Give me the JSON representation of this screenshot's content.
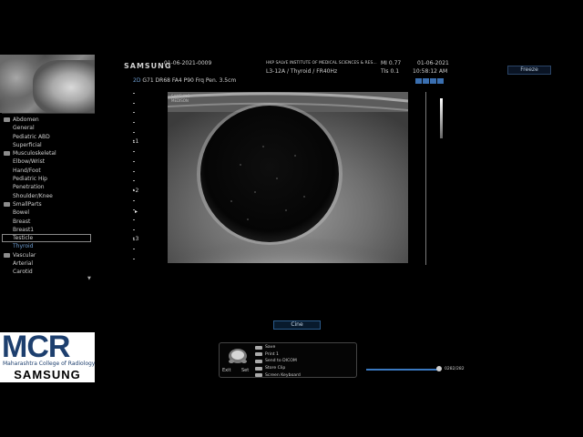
{
  "header": {
    "brand": "SAMSUNG",
    "exam_id": "01-06-2021-0009",
    "institute": "HKP SALVE INSTITUTE OF MEDICAL SCIENCES & RES...",
    "probe_preset": "L3-12A / Thyroid / FR40Hz",
    "mi": "MI  0.77",
    "tis": "TIs  0.1",
    "date": "01-06-2021",
    "time": "10:58:12 AM",
    "freeze_label": "Freeze"
  },
  "image_params": {
    "mode": "2D",
    "line": "G71 DR68 FA4 P90 Frq Pen. 3.5cm"
  },
  "watermark": {
    "line1": "SAMSUNG",
    "line2": "MEDISON"
  },
  "presets": [
    {
      "group": "Abdomen",
      "items": [
        "General",
        "Pediatric ABD",
        "Superficial"
      ]
    },
    {
      "group": "Musculoskeletal",
      "items": [
        "Elbow/Wrist",
        "Hand/Foot",
        "Pediatric Hip",
        "Penetration",
        "Shoulder/Knee"
      ]
    },
    {
      "group": "SmallParts",
      "items": [
        "Bowel",
        "Breast",
        "Breast1",
        "Testicle",
        "Thyroid"
      ]
    },
    {
      "group": "Vascular",
      "items": [
        "Arterial",
        "Carotid"
      ]
    }
  ],
  "selected_preset": "Testicle",
  "active_preset": "Thyroid",
  "depth_scale": {
    "labels": [
      "1",
      "2",
      "3"
    ]
  },
  "logo": {
    "mark": "MCR",
    "subtitle": "Maharashtra College of Radiology",
    "brand": "SAMSUNG"
  },
  "cine_label": "Cine",
  "softmenu": {
    "items": [
      "Save",
      "Print 1",
      "Send to DICOM",
      "Store Clip",
      "Screen Keyboard"
    ],
    "exit_label": "Exit",
    "set_label": "Set"
  },
  "cine_counter": "0282/282",
  "cine_position": 1.0
}
